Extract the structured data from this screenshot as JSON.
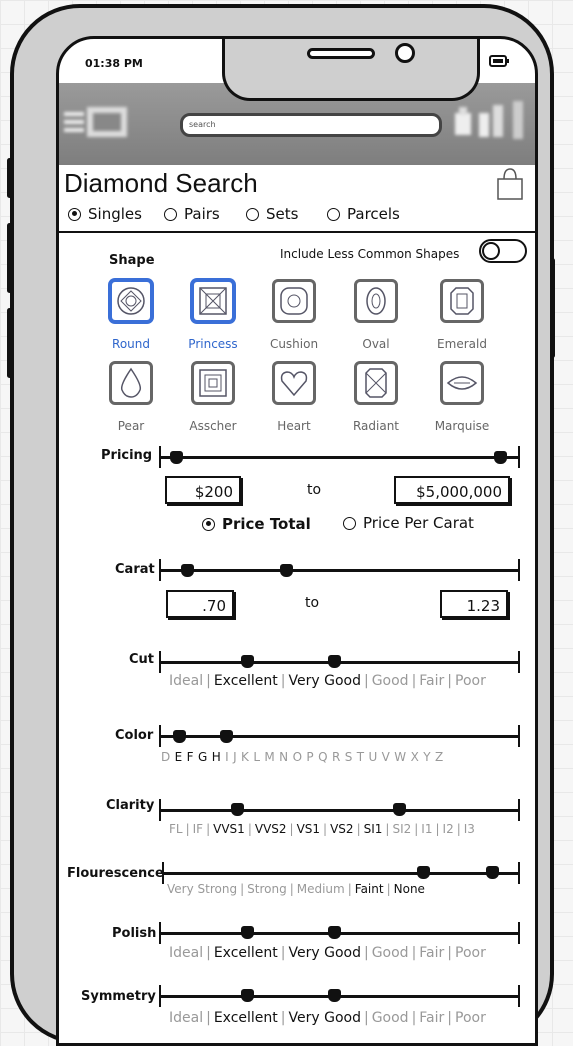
{
  "status": {
    "time": "01:38 PM"
  },
  "search": {
    "placeholder": "search"
  },
  "page": {
    "title": "Diamond Search"
  },
  "tabs": [
    {
      "label": "Singles",
      "selected": true
    },
    {
      "label": "Pairs",
      "selected": false
    },
    {
      "label": "Sets",
      "selected": false
    },
    {
      "label": "Parcels",
      "selected": false
    }
  ],
  "shape": {
    "label": "Shape",
    "toggle_label": "Include Less Common Shapes",
    "toggle_on": false,
    "items": [
      {
        "name": "Round",
        "selected": true
      },
      {
        "name": "Princess",
        "selected": true
      },
      {
        "name": "Cushion",
        "selected": false
      },
      {
        "name": "Oval",
        "selected": false
      },
      {
        "name": "Emerald",
        "selected": false
      },
      {
        "name": "Pear",
        "selected": false
      },
      {
        "name": "Asscher",
        "selected": false
      },
      {
        "name": "Heart",
        "selected": false
      },
      {
        "name": "Radiant",
        "selected": false
      },
      {
        "name": "Marquise",
        "selected": false
      }
    ]
  },
  "pricing": {
    "label": "Pricing",
    "min": "$200",
    "to": "to",
    "max": "$5,000,000",
    "options": [
      {
        "label": "Price Total",
        "selected": true
      },
      {
        "label": "Price Per Carat",
        "selected": false
      }
    ]
  },
  "carat": {
    "label": "Carat",
    "min": ".70",
    "to": "to",
    "max": "1.23"
  },
  "cut": {
    "label": "Cut",
    "grades": [
      "Ideal",
      "Excellent",
      "Very Good",
      "Good",
      "Fair",
      "Poor"
    ],
    "active": [
      "Excellent",
      "Very Good"
    ]
  },
  "color": {
    "label": "Color",
    "grades": [
      "D",
      "E",
      "F",
      "G",
      "H",
      "I",
      "J",
      "K",
      "L",
      "M",
      "N",
      "O",
      "P",
      "Q",
      "R",
      "S",
      "T",
      "U",
      "V",
      "W",
      "X",
      "Y",
      "Z"
    ],
    "active": [
      "E",
      "F",
      "G",
      "H"
    ]
  },
  "clarity": {
    "label": "Clarity",
    "grades": [
      "FL",
      "IF",
      "VVS1",
      "VVS2",
      "VS1",
      "VS2",
      "SI1",
      "SI2",
      "I1",
      "I2",
      "I3"
    ],
    "active": [
      "VVS1",
      "VVS2",
      "VS1",
      "VS2",
      "SI1"
    ]
  },
  "fluorescence": {
    "label": "Flourescence",
    "grades": [
      "Very Strong",
      "Strong",
      "Medium",
      "Faint",
      "None"
    ],
    "active": [
      "Faint",
      "None"
    ]
  },
  "polish": {
    "label": "Polish",
    "grades": [
      "Ideal",
      "Excellent",
      "Very Good",
      "Good",
      "Fair",
      "Poor"
    ],
    "active": [
      "Excellent",
      "Very Good"
    ]
  },
  "symmetry": {
    "label": "Symmetry",
    "grades": [
      "Ideal",
      "Excellent",
      "Very Good",
      "Good",
      "Fair",
      "Poor"
    ],
    "active": [
      "Excellent",
      "Very Good"
    ]
  }
}
